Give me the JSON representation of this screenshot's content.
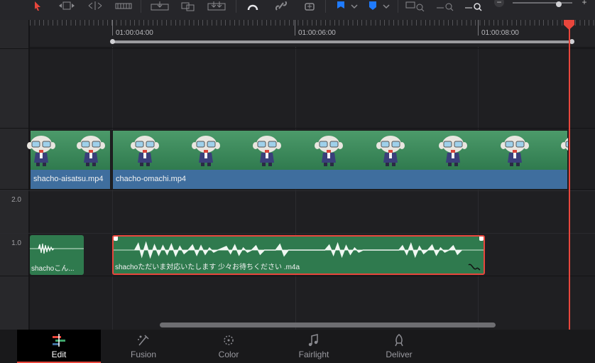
{
  "toolbar": {
    "icons": [
      "select-arrow-icon",
      "trim-icon",
      "dynamic-trim-icon",
      "blade-icon",
      "insert-icon",
      "overwrite-icon",
      "replace-icon",
      "snapping-icon",
      "linked-selection-icon",
      "position-lock-icon",
      "flag-icon",
      "marker-icon",
      "zoom-full-icon",
      "zoom-detail-icon",
      "zoom-custom-icon"
    ],
    "zoom_minus": "−",
    "zoom_plus": "+"
  },
  "ruler": {
    "timecodes": [
      "01:00:04:00",
      "01:00:06:00",
      "01:00:08:00"
    ]
  },
  "tracks": {
    "audio_scale_labels": [
      "2.0",
      "1.0"
    ]
  },
  "clips": {
    "video": [
      {
        "name": "shacho-aisatsu.mp4"
      },
      {
        "name": "chacho-omachi.mp4"
      }
    ],
    "audio": [
      {
        "name": "shachoこん..."
      },
      {
        "name": "shachoただいま対応いたします 少々お待ちください .m4a",
        "selected": true
      }
    ]
  },
  "pages": [
    {
      "label": "Edit",
      "icon": "edit-icon",
      "active": true
    },
    {
      "label": "Fusion",
      "icon": "fusion-icon",
      "active": false
    },
    {
      "label": "Color",
      "icon": "color-icon",
      "active": false
    },
    {
      "label": "Fairlight",
      "icon": "fairlight-icon",
      "active": false
    },
    {
      "label": "Deliver",
      "icon": "deliver-icon",
      "active": false
    }
  ],
  "colors": {
    "accent": "#e8463c",
    "clip_green": "#2f7a4e",
    "clip_blue": "#3f6e9e",
    "flag_blue": "#1f7bff"
  }
}
